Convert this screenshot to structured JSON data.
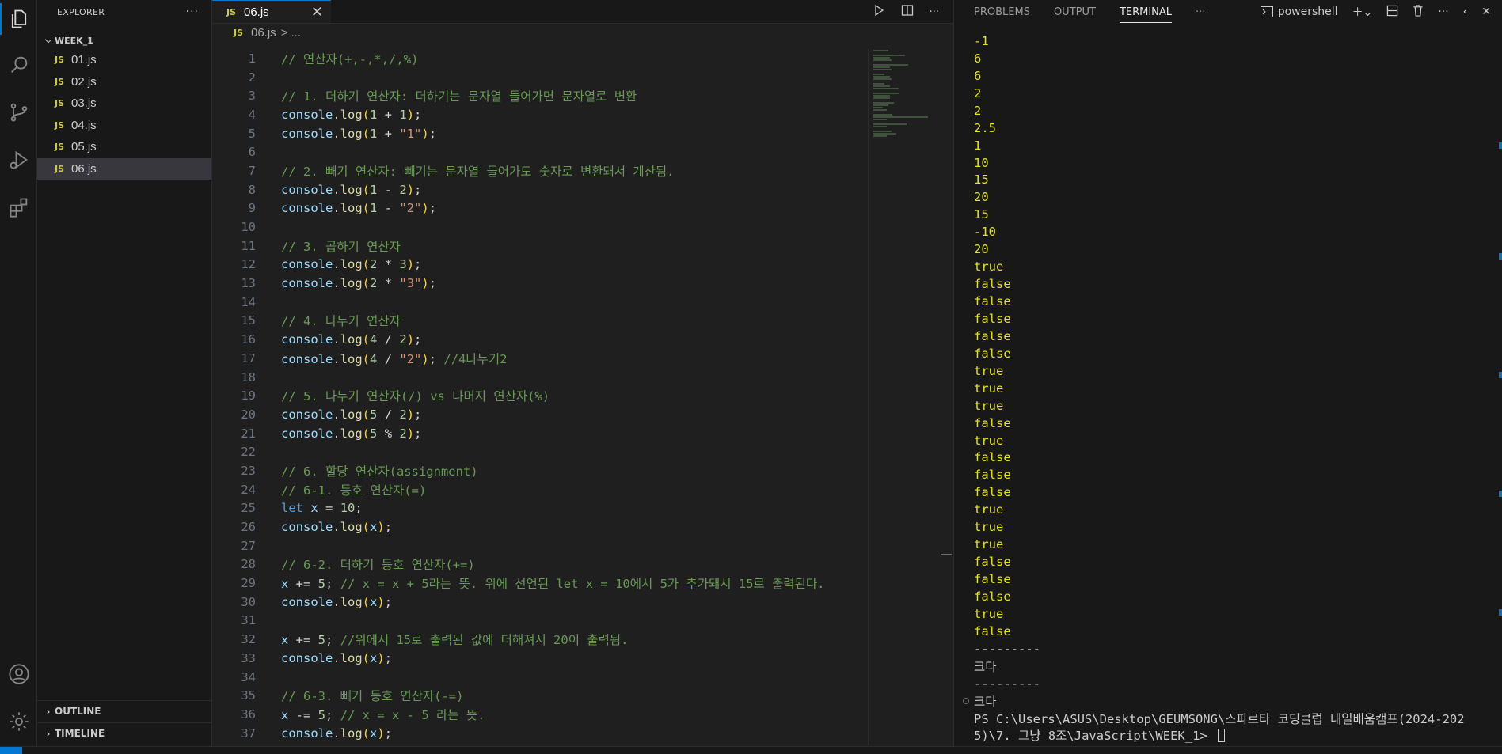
{
  "activity_bar": {
    "items": [
      {
        "name": "explorer-icon"
      },
      {
        "name": "search-icon"
      },
      {
        "name": "source-control-icon"
      },
      {
        "name": "run-debug-icon"
      },
      {
        "name": "extensions-icon"
      }
    ],
    "bottom": [
      {
        "name": "account-icon"
      },
      {
        "name": "settings-gear-icon"
      }
    ]
  },
  "sidebar": {
    "title": "EXPLORER",
    "more": "···",
    "folder": "WEEK_1",
    "badge": "JS",
    "files": [
      "01.js",
      "02.js",
      "03.js",
      "04.js",
      "05.js",
      "06.js"
    ],
    "selected": "06.js",
    "outline": "OUTLINE",
    "timeline": "TIMELINE"
  },
  "editor": {
    "tab_label": "06.js",
    "tab_badge": "JS",
    "close": "✕",
    "breadcrumb_file": "06.js",
    "breadcrumb_rest": "> ...",
    "lines": [
      [
        [
          "cm",
          "// 연산자(+,-,*,/,%)"
        ]
      ],
      [],
      [
        [
          "cm",
          "// 1. 더하기 연산자: 더하기는 문자열 들어가면 문자열로 변환"
        ]
      ],
      [
        [
          "id",
          "console"
        ],
        [
          "op",
          "."
        ],
        [
          "fn",
          "log"
        ],
        [
          "pb",
          "("
        ],
        [
          "nm",
          "1"
        ],
        [
          "op",
          " + "
        ],
        [
          "nm",
          "1"
        ],
        [
          "pb",
          ")"
        ],
        [
          "op",
          ";"
        ]
      ],
      [
        [
          "id",
          "console"
        ],
        [
          "op",
          "."
        ],
        [
          "fn",
          "log"
        ],
        [
          "pb",
          "("
        ],
        [
          "nm",
          "1"
        ],
        [
          "op",
          " + "
        ],
        [
          "st",
          "\"1\""
        ],
        [
          "pb",
          ")"
        ],
        [
          "op",
          ";"
        ]
      ],
      [],
      [
        [
          "cm",
          "// 2. 빼기 연산자: 빼기는 문자열 들어가도 숫자로 변환돼서 계산됨."
        ]
      ],
      [
        [
          "id",
          "console"
        ],
        [
          "op",
          "."
        ],
        [
          "fn",
          "log"
        ],
        [
          "pb",
          "("
        ],
        [
          "nm",
          "1"
        ],
        [
          "op",
          " - "
        ],
        [
          "nm",
          "2"
        ],
        [
          "pb",
          ")"
        ],
        [
          "op",
          ";"
        ]
      ],
      [
        [
          "id",
          "console"
        ],
        [
          "op",
          "."
        ],
        [
          "fn",
          "log"
        ],
        [
          "pb",
          "("
        ],
        [
          "nm",
          "1"
        ],
        [
          "op",
          " - "
        ],
        [
          "st",
          "\"2\""
        ],
        [
          "pb",
          ")"
        ],
        [
          "op",
          ";"
        ]
      ],
      [],
      [
        [
          "cm",
          "// 3. 곱하기 연산자"
        ]
      ],
      [
        [
          "id",
          "console"
        ],
        [
          "op",
          "."
        ],
        [
          "fn",
          "log"
        ],
        [
          "pb",
          "("
        ],
        [
          "nm",
          "2"
        ],
        [
          "op",
          " * "
        ],
        [
          "nm",
          "3"
        ],
        [
          "pb",
          ")"
        ],
        [
          "op",
          ";"
        ]
      ],
      [
        [
          "id",
          "console"
        ],
        [
          "op",
          "."
        ],
        [
          "fn",
          "log"
        ],
        [
          "pb",
          "("
        ],
        [
          "nm",
          "2"
        ],
        [
          "op",
          " * "
        ],
        [
          "st",
          "\"3\""
        ],
        [
          "pb",
          ")"
        ],
        [
          "op",
          ";"
        ]
      ],
      [],
      [
        [
          "cm",
          "// 4. 나누기 연산자"
        ]
      ],
      [
        [
          "id",
          "console"
        ],
        [
          "op",
          "."
        ],
        [
          "fn",
          "log"
        ],
        [
          "pb",
          "("
        ],
        [
          "nm",
          "4"
        ],
        [
          "op",
          " / "
        ],
        [
          "nm",
          "2"
        ],
        [
          "pb",
          ")"
        ],
        [
          "op",
          ";"
        ]
      ],
      [
        [
          "id",
          "console"
        ],
        [
          "op",
          "."
        ],
        [
          "fn",
          "log"
        ],
        [
          "pb",
          "("
        ],
        [
          "nm",
          "4"
        ],
        [
          "op",
          " / "
        ],
        [
          "st",
          "\"2\""
        ],
        [
          "pb",
          ")"
        ],
        [
          "op",
          "; "
        ],
        [
          "cm",
          "//4나누기2"
        ]
      ],
      [],
      [
        [
          "cm",
          "// 5. 나누기 연산자(/) vs 나머지 연산자(%)"
        ]
      ],
      [
        [
          "id",
          "console"
        ],
        [
          "op",
          "."
        ],
        [
          "fn",
          "log"
        ],
        [
          "pb",
          "("
        ],
        [
          "nm",
          "5"
        ],
        [
          "op",
          " / "
        ],
        [
          "nm",
          "2"
        ],
        [
          "pb",
          ")"
        ],
        [
          "op",
          ";"
        ]
      ],
      [
        [
          "id",
          "console"
        ],
        [
          "op",
          "."
        ],
        [
          "fn",
          "log"
        ],
        [
          "pb",
          "("
        ],
        [
          "nm",
          "5"
        ],
        [
          "op",
          " % "
        ],
        [
          "nm",
          "2"
        ],
        [
          "pb",
          ")"
        ],
        [
          "op",
          ";"
        ]
      ],
      [],
      [
        [
          "cm",
          "// 6. 할당 연산자(assignment)"
        ]
      ],
      [
        [
          "cm",
          "// 6-1. 등호 연산자(=)"
        ]
      ],
      [
        [
          "kw",
          "let"
        ],
        [
          "op",
          " "
        ],
        [
          "id",
          "x"
        ],
        [
          "op",
          " = "
        ],
        [
          "nm",
          "10"
        ],
        [
          "op",
          ";"
        ]
      ],
      [
        [
          "id",
          "console"
        ],
        [
          "op",
          "."
        ],
        [
          "fn",
          "log"
        ],
        [
          "pb",
          "("
        ],
        [
          "id",
          "x"
        ],
        [
          "pb",
          ")"
        ],
        [
          "op",
          ";"
        ]
      ],
      [],
      [
        [
          "cm",
          "// 6-2. 더하기 등호 연산자(+=)"
        ]
      ],
      [
        [
          "id",
          "x"
        ],
        [
          "op",
          " += "
        ],
        [
          "nm",
          "5"
        ],
        [
          "op",
          "; "
        ],
        [
          "cm",
          "// x = x + 5라는 뜻. 위에 선언된 let x = 10에서 5가 추가돼서 15로 출력된다."
        ]
      ],
      [
        [
          "id",
          "console"
        ],
        [
          "op",
          "."
        ],
        [
          "fn",
          "log"
        ],
        [
          "pb",
          "("
        ],
        [
          "id",
          "x"
        ],
        [
          "pb",
          ")"
        ],
        [
          "op",
          ";"
        ]
      ],
      [],
      [
        [
          "id",
          "x"
        ],
        [
          "op",
          " += "
        ],
        [
          "nm",
          "5"
        ],
        [
          "op",
          "; "
        ],
        [
          "cm",
          "//위에서 15로 출력된 값에 더해져서 20이 출력됨."
        ]
      ],
      [
        [
          "id",
          "console"
        ],
        [
          "op",
          "."
        ],
        [
          "fn",
          "log"
        ],
        [
          "pb",
          "("
        ],
        [
          "id",
          "x"
        ],
        [
          "pb",
          ")"
        ],
        [
          "op",
          ";"
        ]
      ],
      [],
      [
        [
          "cm",
          "// 6-3. 빼기 등호 연산자(-=)"
        ]
      ],
      [
        [
          "id",
          "x"
        ],
        [
          "op",
          " -= "
        ],
        [
          "nm",
          "5"
        ],
        [
          "op",
          "; "
        ],
        [
          "cm",
          "// x = x - 5 라는 뜻."
        ]
      ],
      [
        [
          "id",
          "console"
        ],
        [
          "op",
          "."
        ],
        [
          "fn",
          "log"
        ],
        [
          "pb",
          "("
        ],
        [
          "id",
          "x"
        ],
        [
          "pb",
          ")"
        ],
        [
          "op",
          ";"
        ]
      ]
    ]
  },
  "panel": {
    "tabs": [
      "PROBLEMS",
      "OUTPUT",
      "TERMINAL"
    ],
    "active_tab": "TERMINAL",
    "more": "···",
    "shell": "powershell",
    "terminal_lines": [
      {
        "t": "-1",
        "c": "y"
      },
      {
        "t": "6",
        "c": "y"
      },
      {
        "t": "6",
        "c": "y"
      },
      {
        "t": "2",
        "c": "y"
      },
      {
        "t": "2",
        "c": "y"
      },
      {
        "t": "2.5",
        "c": "y"
      },
      {
        "t": "1",
        "c": "y"
      },
      {
        "t": "10",
        "c": "y"
      },
      {
        "t": "15",
        "c": "y"
      },
      {
        "t": "20",
        "c": "y"
      },
      {
        "t": "15",
        "c": "y"
      },
      {
        "t": "-10",
        "c": "y"
      },
      {
        "t": "20",
        "c": "y"
      },
      {
        "t": "true",
        "c": "y"
      },
      {
        "t": "false",
        "c": "y"
      },
      {
        "t": "false",
        "c": "y"
      },
      {
        "t": "false",
        "c": "y"
      },
      {
        "t": "false",
        "c": "y"
      },
      {
        "t": "false",
        "c": "y"
      },
      {
        "t": "true",
        "c": "y"
      },
      {
        "t": "true",
        "c": "y"
      },
      {
        "t": "true",
        "c": "y"
      },
      {
        "t": "false",
        "c": "y"
      },
      {
        "t": "true",
        "c": "y"
      },
      {
        "t": "false",
        "c": "y"
      },
      {
        "t": "false",
        "c": "y"
      },
      {
        "t": "false",
        "c": "y"
      },
      {
        "t": "true",
        "c": "y"
      },
      {
        "t": "true",
        "c": "y"
      },
      {
        "t": "true",
        "c": "y"
      },
      {
        "t": "false",
        "c": "y"
      },
      {
        "t": "false",
        "c": "y"
      },
      {
        "t": "false",
        "c": "y"
      },
      {
        "t": "true",
        "c": "y"
      },
      {
        "t": "false",
        "c": "y"
      },
      {
        "t": "---------",
        "c": "dim"
      },
      {
        "t": "크다",
        "c": "dim"
      },
      {
        "t": "---------",
        "c": "dim"
      },
      {
        "t": "크다",
        "c": "dim",
        "mark": true
      },
      {
        "t": "PS C:\\Users\\ASUS\\Desktop\\GEUMSONG\\스파르타 코딩클럽_내일배움캠프(2024-202",
        "c": "dim"
      },
      {
        "t": "5)\\7. 그냥 8조\\JavaScript\\WEEK_1> ",
        "c": "dim",
        "cursor": true
      }
    ]
  },
  "colors": {
    "accent": "#0078d4",
    "js_badge": "#cbcb41",
    "terminal_output": "#e5e510"
  }
}
